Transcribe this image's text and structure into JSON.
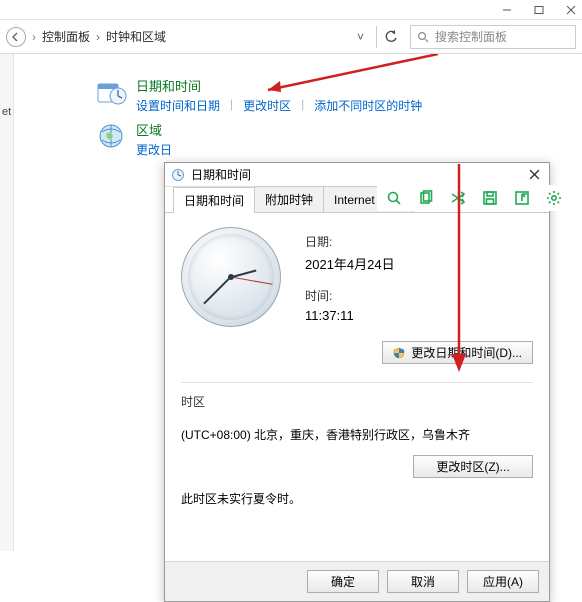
{
  "window": {
    "min_tip": "最小化",
    "max_tip": "最大化",
    "close_tip": "关闭"
  },
  "addressbar": {
    "back_tip": "返回",
    "segments": [
      "控制面板",
      "时钟和区域"
    ],
    "refresh_tip": "刷新"
  },
  "search": {
    "placeholder": "搜索控制面板",
    "icon": "search-icon"
  },
  "left_rail": {
    "label": "et"
  },
  "categories": {
    "datetime": {
      "title": "日期和时间",
      "links": [
        "设置时间和日期",
        "更改时区",
        "添加不同时区的时钟"
      ]
    },
    "region": {
      "title": "区域",
      "link_partial": "更改日"
    }
  },
  "dialog": {
    "title": "日期和时间",
    "tabs": [
      "日期和时间",
      "附加时钟",
      "Internet 时间"
    ],
    "date_label": "日期:",
    "date_value": "2021年4月24日",
    "time_label": "时间:",
    "time_value": "11:37:11",
    "change_datetime_btn": "更改日期和时间(D)...",
    "tz_heading": "时区",
    "tz_value": "(UTC+08:00) 北京，重庆，香港特别行政区，乌鲁木齐",
    "change_tz_btn": "更改时区(Z)...",
    "dst_note": "此时区未实行夏令时。",
    "ok": "确定",
    "cancel": "取消",
    "apply": "应用(A)"
  },
  "toolbar": {
    "items": [
      "magnify",
      "copy",
      "shuffle",
      "save",
      "share",
      "settings"
    ]
  }
}
